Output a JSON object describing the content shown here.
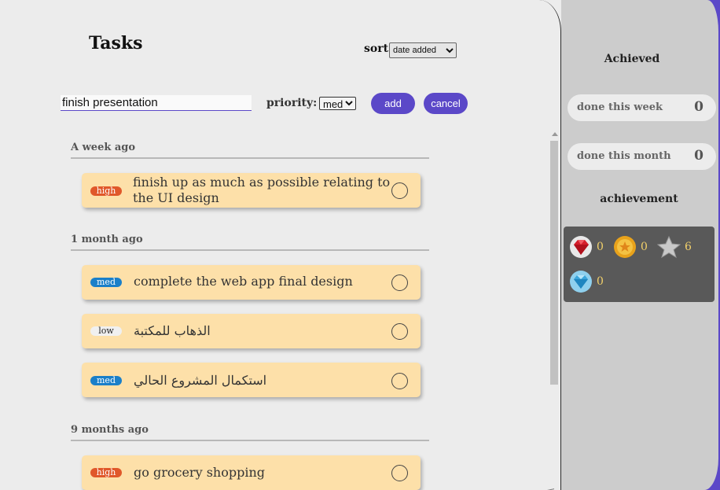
{
  "header": {
    "title": "Tasks",
    "sort_label": "sort:",
    "sort_value": "date added"
  },
  "new_task": {
    "value": "finish presentation",
    "priority_label": "priority:",
    "priority_value": "med",
    "add_label": "add",
    "cancel_label": "cancel"
  },
  "groups": [
    {
      "heading": "A week ago",
      "tasks": [
        {
          "priority": "high",
          "text": "finish up as much as possible relating to the UI design"
        }
      ]
    },
    {
      "heading": "1 month ago",
      "tasks": [
        {
          "priority": "med",
          "text": "complete the web app final design"
        },
        {
          "priority": "low",
          "text": "الذهاب للمكتبة"
        },
        {
          "priority": "med",
          "text": "استكمال المشروع الحالي"
        }
      ]
    },
    {
      "heading": "9 months ago",
      "tasks": [
        {
          "priority": "high",
          "text": "go grocery shopping"
        }
      ]
    }
  ],
  "sidebar": {
    "achieved_title": "Achieved",
    "stats": [
      {
        "label": "done this week",
        "value": "0"
      },
      {
        "label": "done this month",
        "value": "0"
      }
    ],
    "achievement_title": "achievement",
    "badges": [
      {
        "icon": "ruby-icon",
        "count": "0"
      },
      {
        "icon": "gold-medal-icon",
        "count": "0"
      },
      {
        "icon": "silver-star-icon",
        "count": "6"
      },
      {
        "icon": "diamond-icon",
        "count": "0"
      }
    ]
  },
  "colors": {
    "accent": "#5b48c8",
    "card": "#fde0a9",
    "high": "#e0582a",
    "med": "#1a7fc9",
    "low": "#f0f0f0"
  }
}
